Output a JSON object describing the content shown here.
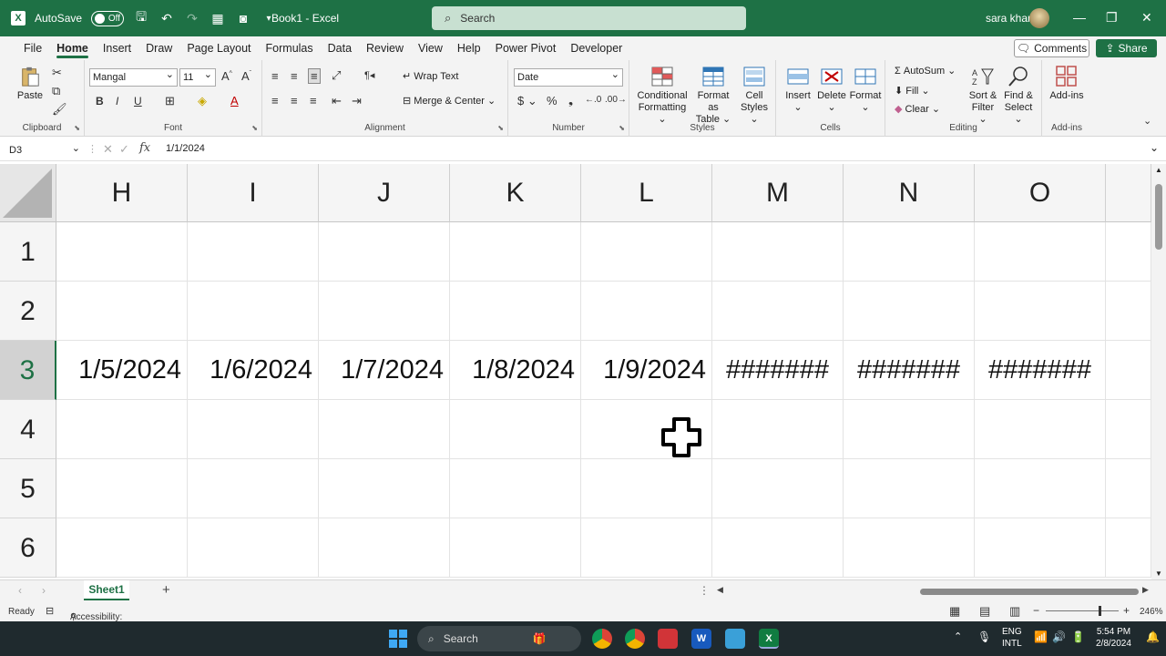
{
  "titlebar": {
    "autosave_label": "AutoSave",
    "autosave_state": "Off",
    "doc_title": "Book1 - Excel",
    "search_placeholder": "Search",
    "user_name": "sara khan"
  },
  "menu": {
    "tabs": [
      "File",
      "Home",
      "Insert",
      "Draw",
      "Page Layout",
      "Formulas",
      "Data",
      "Review",
      "View",
      "Help",
      "Power Pivot",
      "Developer"
    ],
    "active": "Home",
    "comments_label": "Comments",
    "share_label": "Share"
  },
  "ribbon": {
    "clipboard": {
      "label": "Clipboard",
      "paste": "Paste"
    },
    "font": {
      "label": "Font",
      "name": "Mangal",
      "size": "11"
    },
    "alignment": {
      "label": "Alignment",
      "wrap_text": "Wrap Text",
      "merge_center": "Merge & Center"
    },
    "number": {
      "label": "Number",
      "format": "Date"
    },
    "styles": {
      "label": "Styles",
      "conditional_1": "Conditional",
      "conditional_2": "Formatting",
      "format_table_1": "Format as",
      "format_table_2": "Table",
      "cell_styles_1": "Cell",
      "cell_styles_2": "Styles"
    },
    "cells": {
      "label": "Cells",
      "insert": "Insert",
      "delete": "Delete",
      "format": "Format"
    },
    "editing": {
      "label": "Editing",
      "autosum": "AutoSum",
      "fill": "Fill",
      "clear": "Clear",
      "sort_1": "Sort &",
      "sort_2": "Filter",
      "find_1": "Find &",
      "find_2": "Select"
    },
    "addins": {
      "label": "Add-ins",
      "addins": "Add-ins"
    }
  },
  "formula_bar": {
    "name_box": "D3",
    "value": "1/1/2024"
  },
  "grid": {
    "columns": [
      "H",
      "I",
      "J",
      "K",
      "L",
      "M",
      "N",
      "O"
    ],
    "rows": [
      "1",
      "2",
      "3",
      "4",
      "5",
      "6"
    ],
    "selected_row": "3",
    "row3_values": [
      "1/5/2024",
      "1/6/2024",
      "1/7/2024",
      "1/8/2024",
      "1/9/2024",
      "#######",
      "#######",
      "#######"
    ]
  },
  "sheets": {
    "active": "Sheet1"
  },
  "status": {
    "ready": "Ready",
    "accessibility": "Accessibility: Good to go",
    "zoom": "246%"
  },
  "taskbar": {
    "search": "Search",
    "lang_1": "ENG",
    "lang_2": "INTL",
    "time": "5:54 PM",
    "date": "2/8/2024"
  },
  "colors": {
    "accent": "#1e7145",
    "taskbar": "#1f2a2e"
  }
}
